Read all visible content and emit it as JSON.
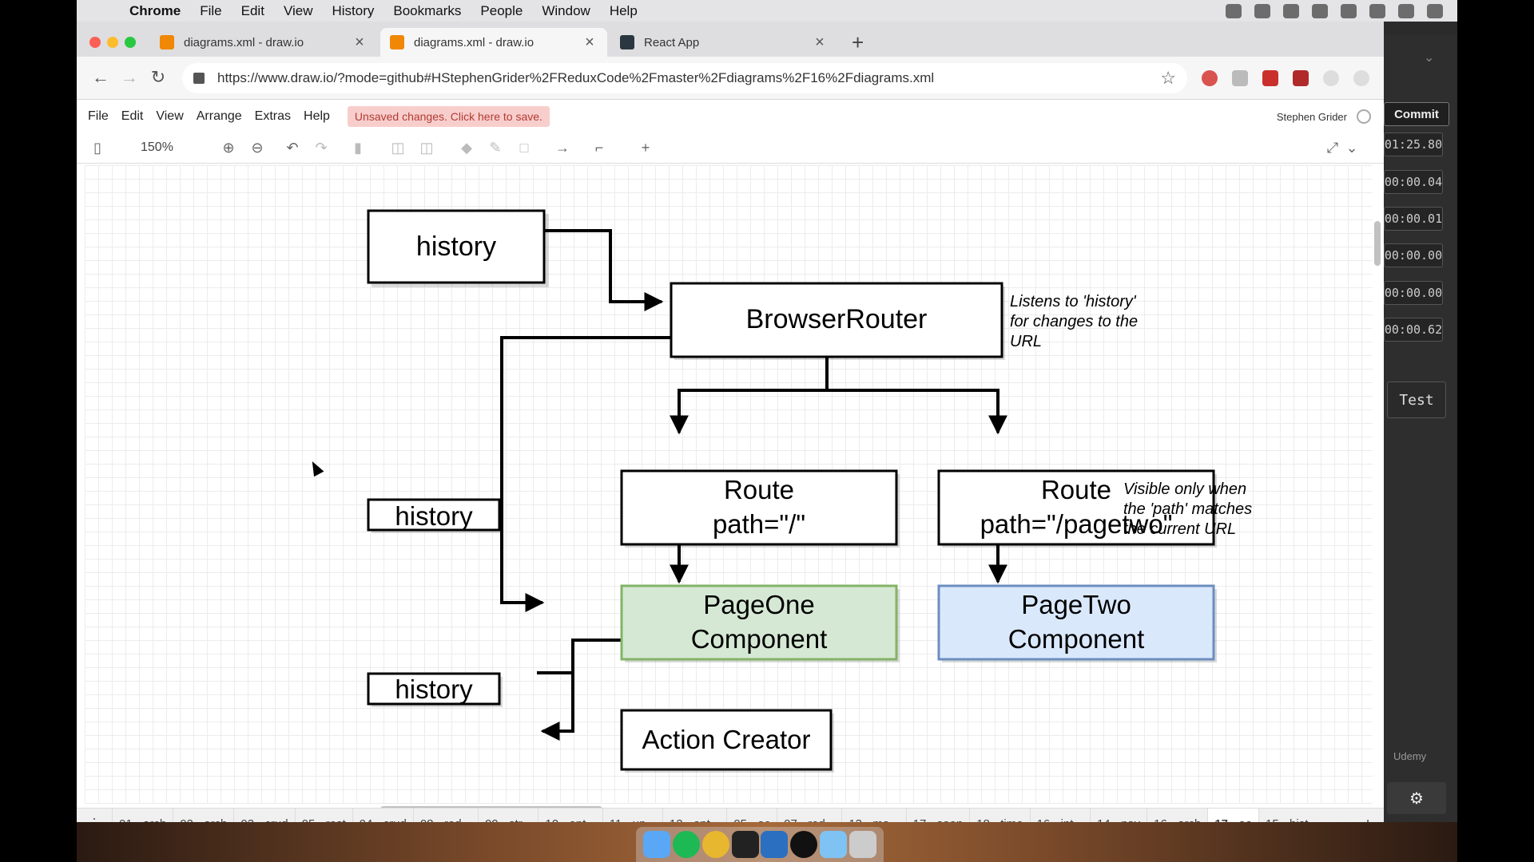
{
  "menubar": {
    "app": "Chrome",
    "items": [
      "File",
      "Edit",
      "View",
      "History",
      "Bookmarks",
      "People",
      "Window",
      "Help"
    ]
  },
  "tabs": [
    {
      "title": "diagrams.xml - draw.io",
      "icon": "drawio-icon",
      "active": false
    },
    {
      "title": "diagrams.xml - draw.io",
      "icon": "drawio-icon",
      "active": true
    },
    {
      "title": "React App",
      "icon": "react-icon",
      "active": false
    }
  ],
  "address": {
    "url": "https://www.draw.io/?mode=github#HStephenGrider%2FReduxCode%2Fmaster%2Fdiagrams%2F16%2Fdiagrams.xml"
  },
  "drawio": {
    "menu": [
      "File",
      "Edit",
      "View",
      "Arrange",
      "Extras",
      "Help"
    ],
    "unsaved": "Unsaved changes. Click here to save.",
    "user": "Stephen Grider",
    "zoom": "150%"
  },
  "diagram": {
    "history_top": "history",
    "browser_router": "BrowserRouter",
    "note_router": [
      "Listens to 'history'",
      "for changes to the",
      "URL"
    ],
    "route1": [
      "Route",
      "path=\"/\""
    ],
    "route2": [
      "Route",
      "path=\"/pagetwo\""
    ],
    "note_route": [
      "Visible only when",
      "the 'path' matches",
      "the current URL"
    ],
    "history_mid": "history",
    "page_one": [
      "PageOne",
      "Component"
    ],
    "page_two": [
      "PageTwo",
      "Component"
    ],
    "history_bottom": "history",
    "action_creator": "Action Creator",
    "colors": {
      "page_one_fill": "#d5e8d4",
      "page_one_stroke": "#82b366",
      "page_two_fill": "#dae8fc",
      "page_two_stroke": "#6c8ebf"
    }
  },
  "pages": [
    "01 - arch",
    "02 - arch",
    "03 - crud",
    "05 - rest",
    "04 - crud",
    "08 - red...",
    "09 - str...",
    "10 - opt...",
    "11 - up...",
    "12 - opt...",
    "05 - ac",
    "07 - red...",
    "13 - ma...",
    "17 - soon",
    "18 - time",
    "16 - int...",
    "14 - nav",
    "16 - arch",
    "17 - ac",
    "15 - hist..."
  ],
  "active_page": "17 - ac",
  "right_panel": {
    "commit": "Commit",
    "timers": [
      "01:25.80",
      "00:00.04",
      "00:00.01",
      "00:00.00",
      "00:00.00",
      "00:00.62"
    ],
    "test": "Test",
    "brand": "Udemy"
  }
}
